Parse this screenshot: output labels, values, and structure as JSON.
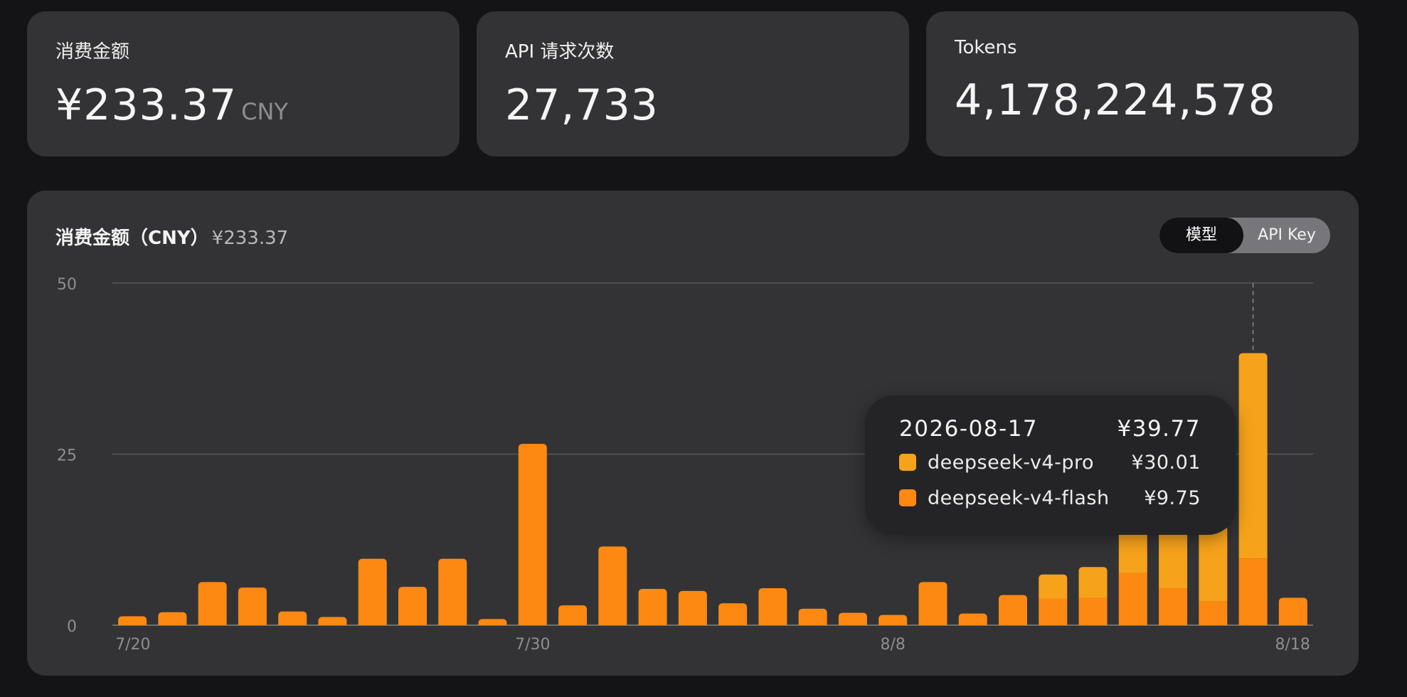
{
  "cards": {
    "cost": {
      "label": "消费金额",
      "value": "¥233.37",
      "unit": "CNY"
    },
    "requests": {
      "label": "API 请求次数",
      "value": "27,733"
    },
    "tokens": {
      "label": "Tokens",
      "value": "4,178,224,578"
    }
  },
  "panel": {
    "title": "消费金额（CNY）",
    "total": "¥233.37",
    "toggle": {
      "active": "模型",
      "inactive": "API Key"
    }
  },
  "tooltip": {
    "date": "2026-08-17",
    "total": "¥39.77",
    "items": [
      {
        "name": "deepseek-v4-pro",
        "value": "¥30.01"
      },
      {
        "name": "deepseek-v4-flash",
        "value": "¥9.75"
      }
    ]
  },
  "colors": {
    "pro": "#f7a21b",
    "flash": "#fd8913"
  },
  "chart_data": {
    "type": "bar",
    "stacked": true,
    "ylim": [
      0,
      50
    ],
    "yticks": [
      0,
      25,
      50
    ],
    "grid": true,
    "x": [
      "7/20",
      "7/21",
      "7/22",
      "7/23",
      "7/24",
      "7/25",
      "7/26",
      "7/27",
      "7/28",
      "7/29",
      "7/30",
      "7/31",
      "8/1",
      "8/2",
      "8/3",
      "8/4",
      "8/5",
      "8/6",
      "8/7",
      "8/8",
      "8/9",
      "8/10",
      "8/11",
      "8/12",
      "8/13",
      "8/14",
      "8/15",
      "8/16",
      "8/17",
      "8/18"
    ],
    "xtick_labels": [
      "7/20",
      "7/30",
      "8/8",
      "8/18"
    ],
    "series": [
      {
        "name": "deepseek-v4-flash",
        "values": [
          1.3,
          1.9,
          6.3,
          5.5,
          2.0,
          1.2,
          9.7,
          5.6,
          9.7,
          0.9,
          26.5,
          2.9,
          11.5,
          5.3,
          5.0,
          3.2,
          5.4,
          2.4,
          1.8,
          1.5,
          6.3,
          1.7,
          4.4,
          3.9,
          4.0,
          7.6,
          5.4,
          3.5,
          9.75,
          4.0
        ]
      },
      {
        "name": "deepseek-v4-pro",
        "values": [
          0,
          0,
          0,
          0,
          0,
          0,
          0,
          0,
          0,
          0,
          0,
          0,
          0,
          0,
          0,
          0,
          0,
          0,
          0,
          0,
          0,
          0,
          0,
          3.5,
          4.5,
          8.0,
          9.5,
          11.0,
          30.01,
          0
        ]
      }
    ],
    "highlight_x": "8/17"
  }
}
